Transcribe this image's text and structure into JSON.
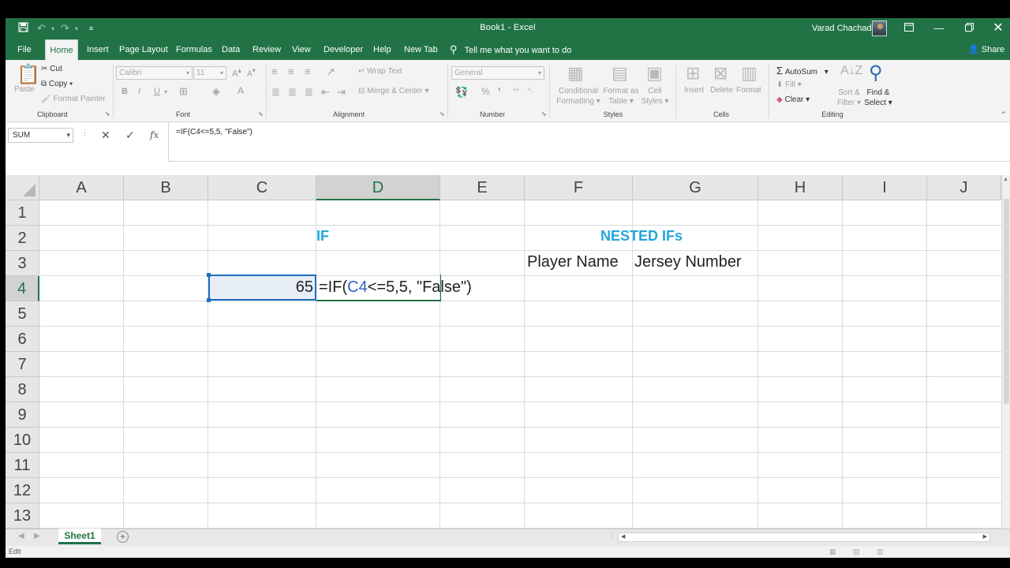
{
  "title_bar": {
    "document_title": "Book1  -  Excel",
    "user_name": "Varad Chachad",
    "quick_access": [
      "save-icon",
      "undo-icon",
      "redo-icon",
      "customize-icon"
    ],
    "accent_color": "#217346"
  },
  "tabs": [
    {
      "label": "File"
    },
    {
      "label": "Home"
    },
    {
      "label": "Insert"
    },
    {
      "label": "Page Layout"
    },
    {
      "label": "Formulas"
    },
    {
      "label": "Data"
    },
    {
      "label": "Review"
    },
    {
      "label": "View"
    },
    {
      "label": "Developer"
    },
    {
      "label": "Help"
    },
    {
      "label": "New Tab"
    }
  ],
  "tell_me": "Tell me what you want to do",
  "share": "Share",
  "ribbon": {
    "clipboard": {
      "paste": "Paste",
      "cut": "Cut",
      "copy": "Copy",
      "format_painter": "Format Painter",
      "label": "Clipboard"
    },
    "font": {
      "name": "Calibri",
      "size": "11",
      "label": "Font"
    },
    "alignment": {
      "wrap": "Wrap Text",
      "merge": "Merge & Center",
      "label": "Alignment"
    },
    "number": {
      "format": "General",
      "label": "Number"
    },
    "styles": {
      "conditional_1": "Conditional",
      "conditional_2": "Formatting",
      "format_table_1": "Format as",
      "format_table_2": "Table",
      "cell_styles_1": "Cell",
      "cell_styles_2": "Styles",
      "label": "Styles"
    },
    "cells": {
      "insert": "Insert",
      "delete": "Delete",
      "format": "Format",
      "label": "Cells"
    },
    "editing": {
      "autosum": "AutoSum",
      "fill": "Fill",
      "clear": "Clear",
      "sort_1": "Sort &",
      "sort_2": "Filter",
      "find_1": "Find &",
      "find_2": "Select",
      "label": "Editing"
    }
  },
  "formula_bar": {
    "name_box": "SUM",
    "formula": "=IF(C4<=5,5, \"False\")"
  },
  "columns": [
    "A",
    "B",
    "C",
    "D",
    "E",
    "F",
    "G",
    "H",
    "I",
    "J"
  ],
  "rows": [
    "1",
    "2",
    "3",
    "4",
    "5",
    "6",
    "7",
    "8",
    "9",
    "10",
    "11",
    "12",
    "13"
  ],
  "cells": {
    "D2": "IF",
    "F2": "NESTED IFs",
    "F3": "Player Name",
    "G3": "Jersey Number",
    "C4": "65",
    "D4_pre": "=IF(",
    "D4_ref": "C4",
    "D4_post": "<=5,5, \"False\")"
  },
  "sheet_tab": "Sheet1",
  "status": "Edit"
}
